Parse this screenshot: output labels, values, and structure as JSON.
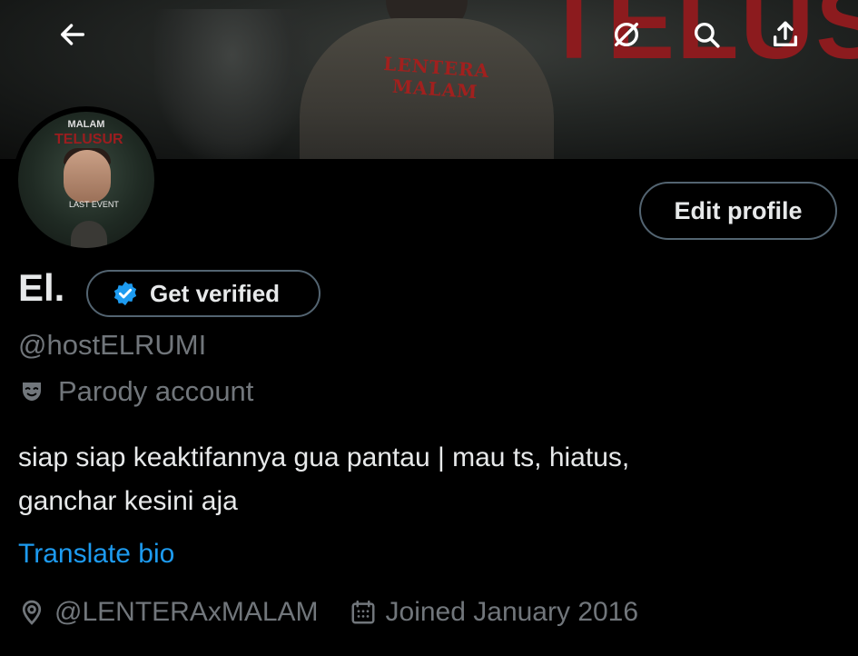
{
  "banner": {
    "shirt_text": "LENTERA MALAM",
    "title_text": "TELUSUR"
  },
  "avatar": {
    "title": "MALAM",
    "red_text": "TELUSUR",
    "tag": "LAST EVENT"
  },
  "toolbar": {
    "back_icon": "arrow-left-icon",
    "grok_icon": "grok-icon",
    "search_icon": "search-icon",
    "share_icon": "share-icon"
  },
  "profile": {
    "edit_label": "Edit profile",
    "name": "El.",
    "verify_label": "Get verified",
    "handle": "@hostELRUMI",
    "parody_label": "Parody account",
    "bio_lines": [
      "siap siap keaktifannya gua pantau | mau ts, hiatus,",
      "ganchar kesini aja"
    ],
    "translate_label": "Translate bio",
    "location": "@LENTERAxMALAM",
    "joined": "Joined January 2016"
  },
  "colors": {
    "background": "#000000",
    "text_primary": "#e7e9ea",
    "text_secondary": "#71767b",
    "link": "#1d9bf0",
    "verified_badge": "#1d9bf0",
    "button_border": "#536471"
  }
}
